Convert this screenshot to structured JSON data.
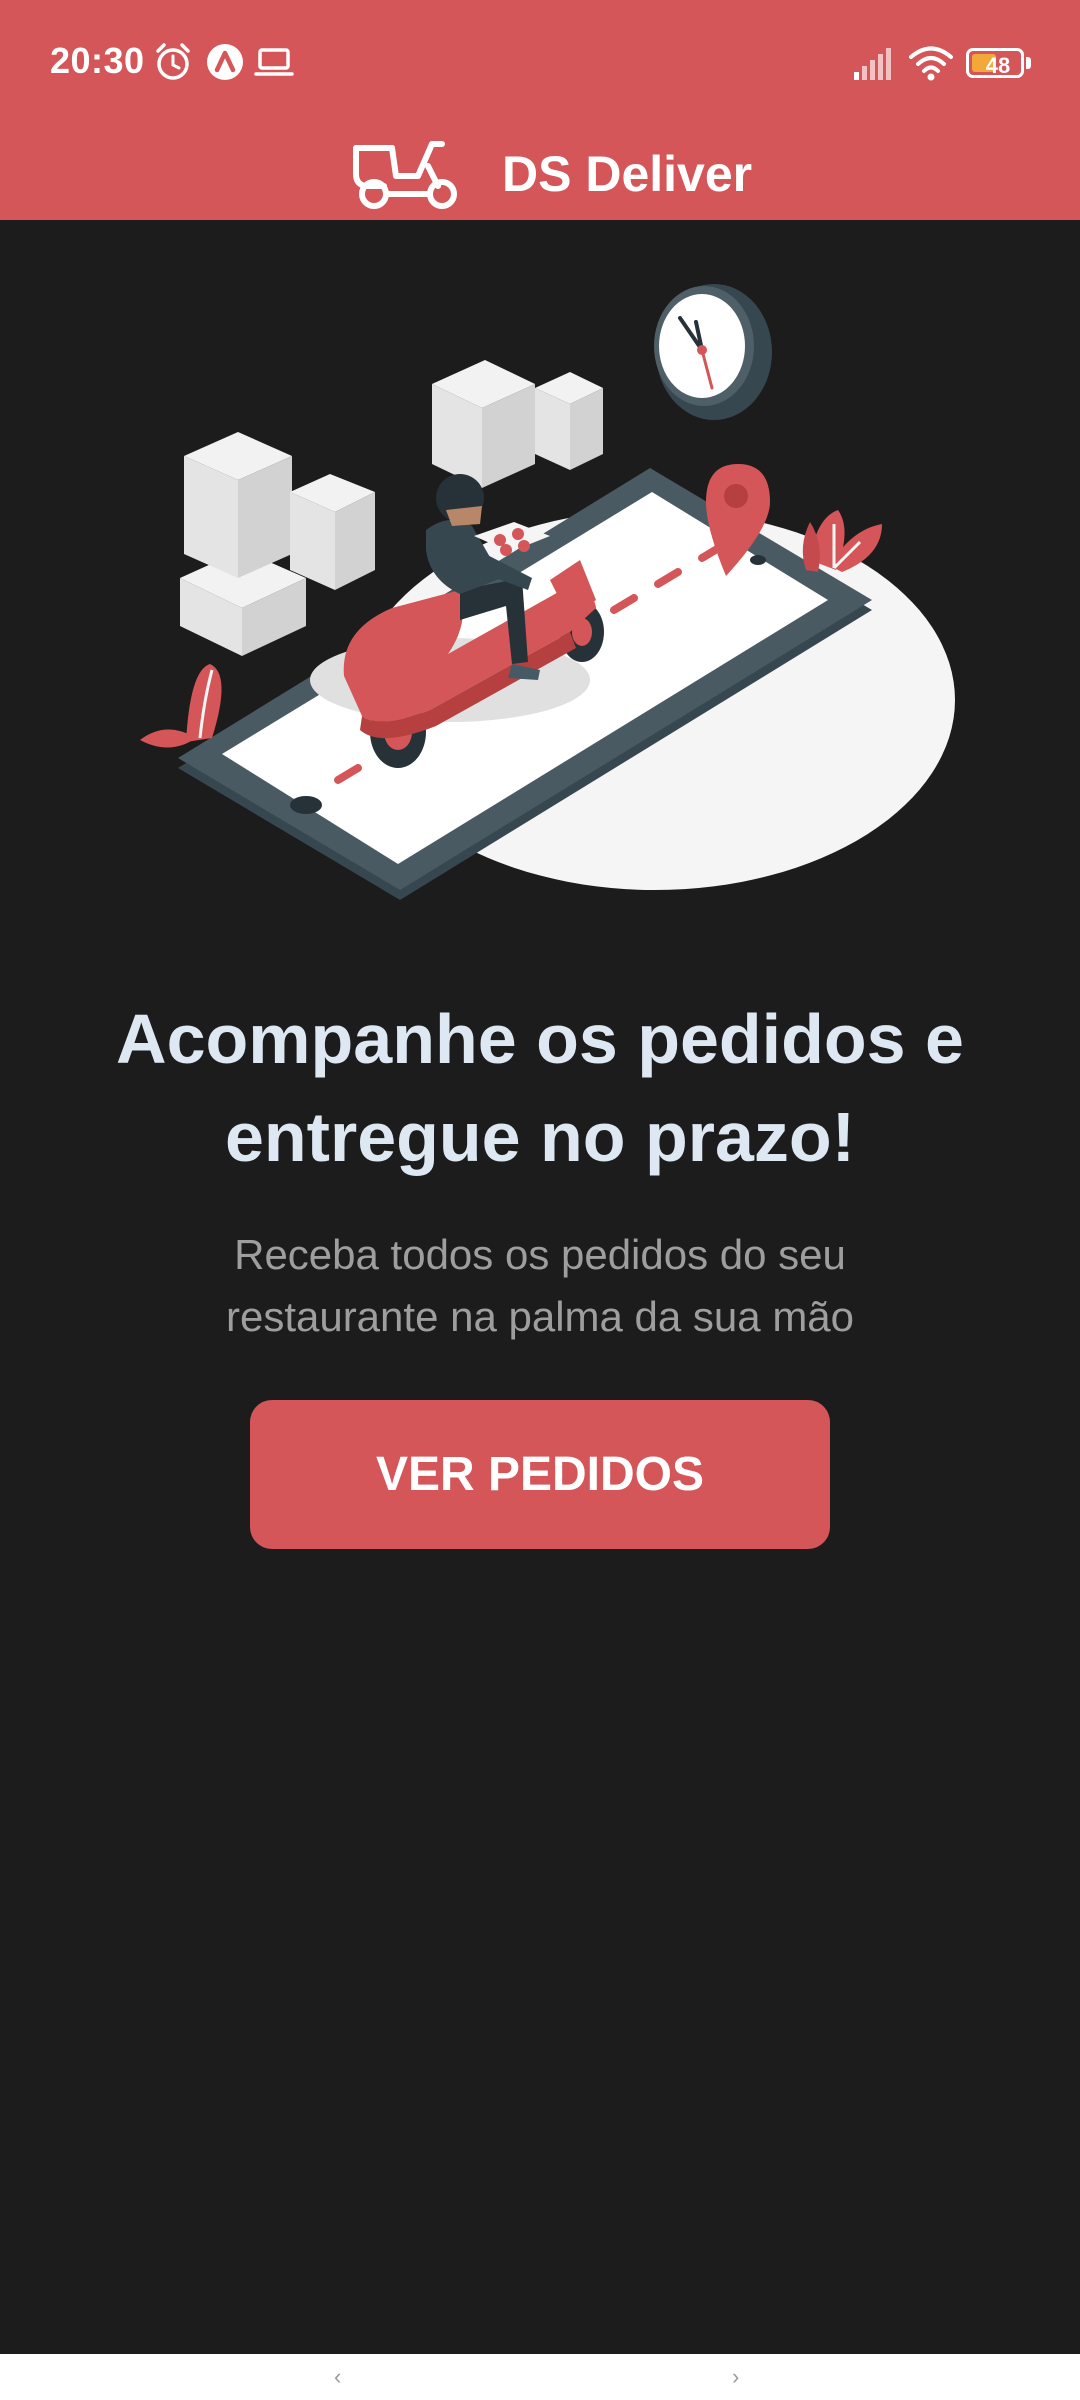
{
  "status_bar": {
    "time": "20:30",
    "battery_level": "48",
    "icons": [
      "alarm-icon",
      "app-a-icon",
      "laptop-icon",
      "signal-icon",
      "wifi-icon",
      "battery-icon"
    ]
  },
  "header": {
    "title": "DS Deliver",
    "logo": "scooter-icon",
    "background_color": "#d45659"
  },
  "hero": {
    "illustration": "delivery-scooter-on-phone-illustration",
    "headline_line1": "Acompanhe os pedidos e",
    "headline_line2": "entregue no prazo!",
    "subtitle_line1": "Receba todos os pedidos do seu",
    "subtitle_line2": "restaurante na palma da sua mão"
  },
  "actions": {
    "primary_label": "VER PEDIDOS",
    "primary_color": "#d45659"
  },
  "system_nav": {
    "back": "‹",
    "forward": "›"
  },
  "colors": {
    "background": "#1c1c1c",
    "headline": "#dde8f2",
    "subtitle": "#9e9e9e"
  }
}
